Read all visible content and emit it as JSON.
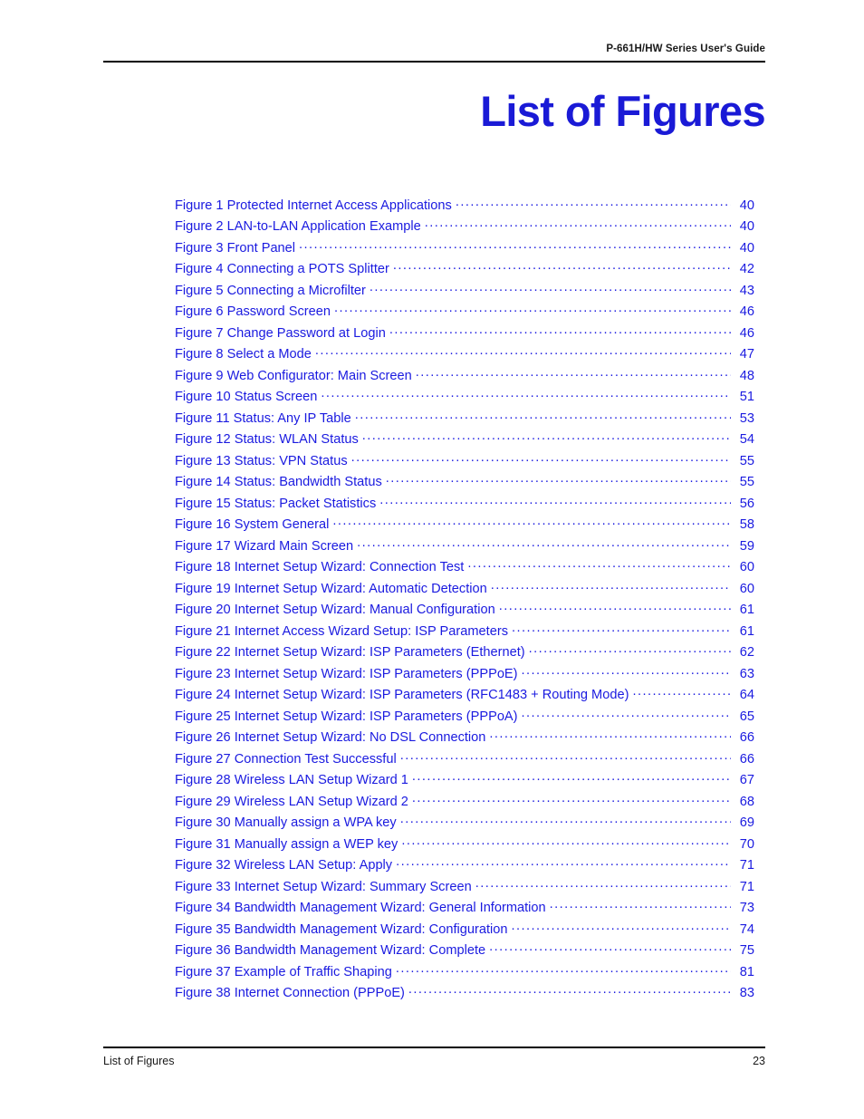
{
  "header": {
    "running_title": "P-661H/HW Series User's Guide"
  },
  "title": "List of Figures",
  "colors": {
    "link_blue": "#1a1ae0",
    "title_blue": "#1a1ad6",
    "rule_black": "#000000"
  },
  "figures": [
    {
      "label": "Figure 1 Protected Internet Access Applications",
      "page": "40"
    },
    {
      "label": "Figure 2 LAN-to-LAN Application Example",
      "page": "40"
    },
    {
      "label": "Figure 3 Front Panel",
      "page": "40"
    },
    {
      "label": "Figure 4 Connecting a POTS Splitter",
      "page": "42"
    },
    {
      "label": "Figure 5 Connecting a Microfilter",
      "page": "43"
    },
    {
      "label": "Figure 6 Password Screen",
      "page": "46"
    },
    {
      "label": "Figure 7 Change Password at Login",
      "page": "46"
    },
    {
      "label": "Figure 8 Select a Mode",
      "page": "47"
    },
    {
      "label": "Figure 9 Web Configurator: Main Screen",
      "page": "48"
    },
    {
      "label": "Figure 10 Status Screen",
      "page": "51"
    },
    {
      "label": "Figure 11 Status: Any IP Table",
      "page": "53"
    },
    {
      "label": "Figure 12 Status: WLAN Status",
      "page": "54"
    },
    {
      "label": "Figure 13 Status: VPN Status",
      "page": "55"
    },
    {
      "label": "Figure 14 Status: Bandwidth Status",
      "page": "55"
    },
    {
      "label": "Figure 15 Status: Packet Statistics",
      "page": "56"
    },
    {
      "label": "Figure 16 System General",
      "page": "58"
    },
    {
      "label": "Figure 17 Wizard Main Screen",
      "page": "59"
    },
    {
      "label": "Figure 18 Internet Setup Wizard: Connection Test",
      "page": "60"
    },
    {
      "label": "Figure 19 Internet Setup Wizard: Automatic Detection",
      "page": "60"
    },
    {
      "label": "Figure 20 Internet Setup Wizard: Manual Configuration",
      "page": "61"
    },
    {
      "label": "Figure 21 Internet Access Wizard Setup: ISP Parameters",
      "page": "61"
    },
    {
      "label": "Figure 22 Internet Setup Wizard: ISP Parameters (Ethernet)",
      "page": "62"
    },
    {
      "label": "Figure 23 Internet Setup Wizard: ISP Parameters (PPPoE)",
      "page": "63"
    },
    {
      "label": "Figure 24 Internet Setup Wizard: ISP Parameters (RFC1483 + Routing Mode)",
      "page": "64"
    },
    {
      "label": "Figure 25 Internet Setup Wizard: ISP Parameters (PPPoA)",
      "page": "65"
    },
    {
      "label": "Figure 26 Internet Setup Wizard: No DSL Connection",
      "page": "66"
    },
    {
      "label": "Figure 27 Connection Test Successful",
      "page": "66"
    },
    {
      "label": "Figure 28 Wireless LAN Setup Wizard 1",
      "page": "67"
    },
    {
      "label": "Figure 29 Wireless LAN Setup Wizard 2",
      "page": "68"
    },
    {
      "label": "Figure 30 Manually assign a WPA key",
      "page": "69"
    },
    {
      "label": "Figure 31 Manually assign a WEP key",
      "page": "70"
    },
    {
      "label": "Figure 32 Wireless LAN Setup: Apply",
      "page": "71"
    },
    {
      "label": "Figure 33 Internet Setup Wizard: Summary Screen",
      "page": "71"
    },
    {
      "label": "Figure 34 Bandwidth Management Wizard: General Information",
      "page": "73"
    },
    {
      "label": "Figure 35 Bandwidth Management Wizard: Configuration",
      "page": "74"
    },
    {
      "label": "Figure 36 Bandwidth Management Wizard: Complete",
      "page": "75"
    },
    {
      "label": "Figure 37 Example of Traffic Shaping",
      "page": "81"
    },
    {
      "label": "Figure 38 Internet Connection (PPPoE)",
      "page": "83"
    }
  ],
  "footer": {
    "section": "List of Figures",
    "page_number": "23"
  }
}
